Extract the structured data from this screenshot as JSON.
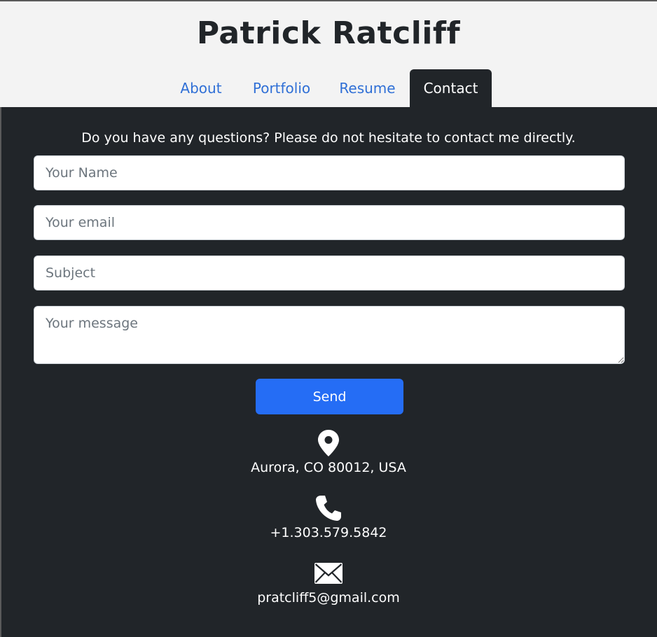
{
  "header": {
    "title": "Patrick Ratcliff",
    "tabs": [
      {
        "label": "About"
      },
      {
        "label": "Portfolio"
      },
      {
        "label": "Resume"
      },
      {
        "label": "Contact"
      }
    ],
    "active_tab": "Contact"
  },
  "contact": {
    "intro": "Do you have any questions? Please do not hesitate to contact me directly.",
    "form": {
      "name_placeholder": "Your Name",
      "email_placeholder": "Your email",
      "subject_placeholder": "Subject",
      "message_placeholder": "Your message",
      "name_value": "",
      "email_value": "",
      "subject_value": "",
      "message_value": "",
      "send_label": "Send"
    },
    "info": {
      "location": {
        "icon": "map-pin-icon",
        "text": "Aurora, CO 80012, USA"
      },
      "phone": {
        "icon": "phone-icon",
        "text": "+1.303.579.5842"
      },
      "email": {
        "icon": "envelope-icon",
        "text": "pratcliff5@gmail.com"
      }
    }
  },
  "colors": {
    "header_bg": "#f3f3f3",
    "page_bg": "#212529",
    "link": "#2f6fd6",
    "accent": "#256df5"
  }
}
